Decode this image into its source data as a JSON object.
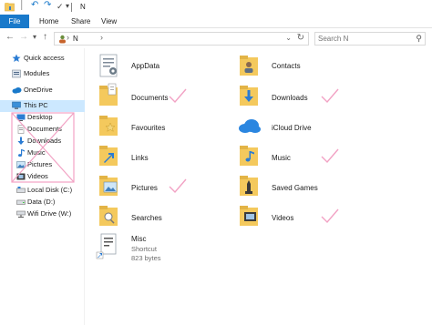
{
  "window": {
    "title": "N"
  },
  "ribbon": {
    "file": "File",
    "home": "Home",
    "share": "Share",
    "view": "View"
  },
  "address": {
    "crumb": "N",
    "chevron": "›"
  },
  "search": {
    "placeholder": "Search N"
  },
  "sidebar": {
    "quick_access": "Quick access",
    "modules": "Modules",
    "onedrive": "OneDrive",
    "this_pc": "This PC",
    "children": [
      "Desktop",
      "Documents",
      "Downloads",
      "Music",
      "Pictures",
      "Videos"
    ],
    "local_disk": "Local Disk (C:)",
    "data": "Data (D:)",
    "wifi": "Wifi Drive (W:)"
  },
  "main": {
    "left": [
      "AppData",
      "Documents",
      "Favourites",
      "Links",
      "Pictures",
      "Searches"
    ],
    "right": [
      "Contacts",
      "Downloads",
      "iCloud Drive",
      "Music",
      "Saved Games",
      "Videos"
    ],
    "misc": {
      "name": "Misc",
      "type": "Shortcut",
      "size": "823 bytes"
    }
  },
  "colors": {
    "accent": "#1979ca",
    "selection": "#cce8ff",
    "folder": "#f4c95d",
    "annotation": "#f2a2c4"
  }
}
